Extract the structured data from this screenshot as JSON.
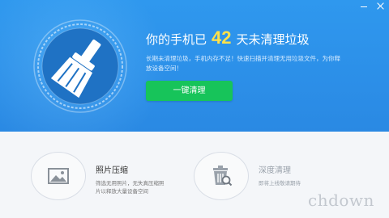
{
  "header": {
    "title_prefix": "你的手机已",
    "days": "42",
    "title_suffix": "天未清理垃圾",
    "description": "长期未清理垃圾，手机内存不足！快速扫描并清理无用垃圾文件，为你释放设备空间！",
    "clean_button": "一键清理"
  },
  "tools": [
    {
      "title": "照片压缩",
      "description": "筛选无用照片，无失真压缩照片以释放大量设备空间",
      "icon": "image-icon"
    },
    {
      "title": "深度清理",
      "description": "即将上线敬请期待",
      "icon": "trash-search-icon"
    }
  ],
  "watermark": "chdown",
  "colors": {
    "hero_blue": "#2c8fe8",
    "accent_green": "#17c45a",
    "days_yellow": "#ffe14a"
  }
}
